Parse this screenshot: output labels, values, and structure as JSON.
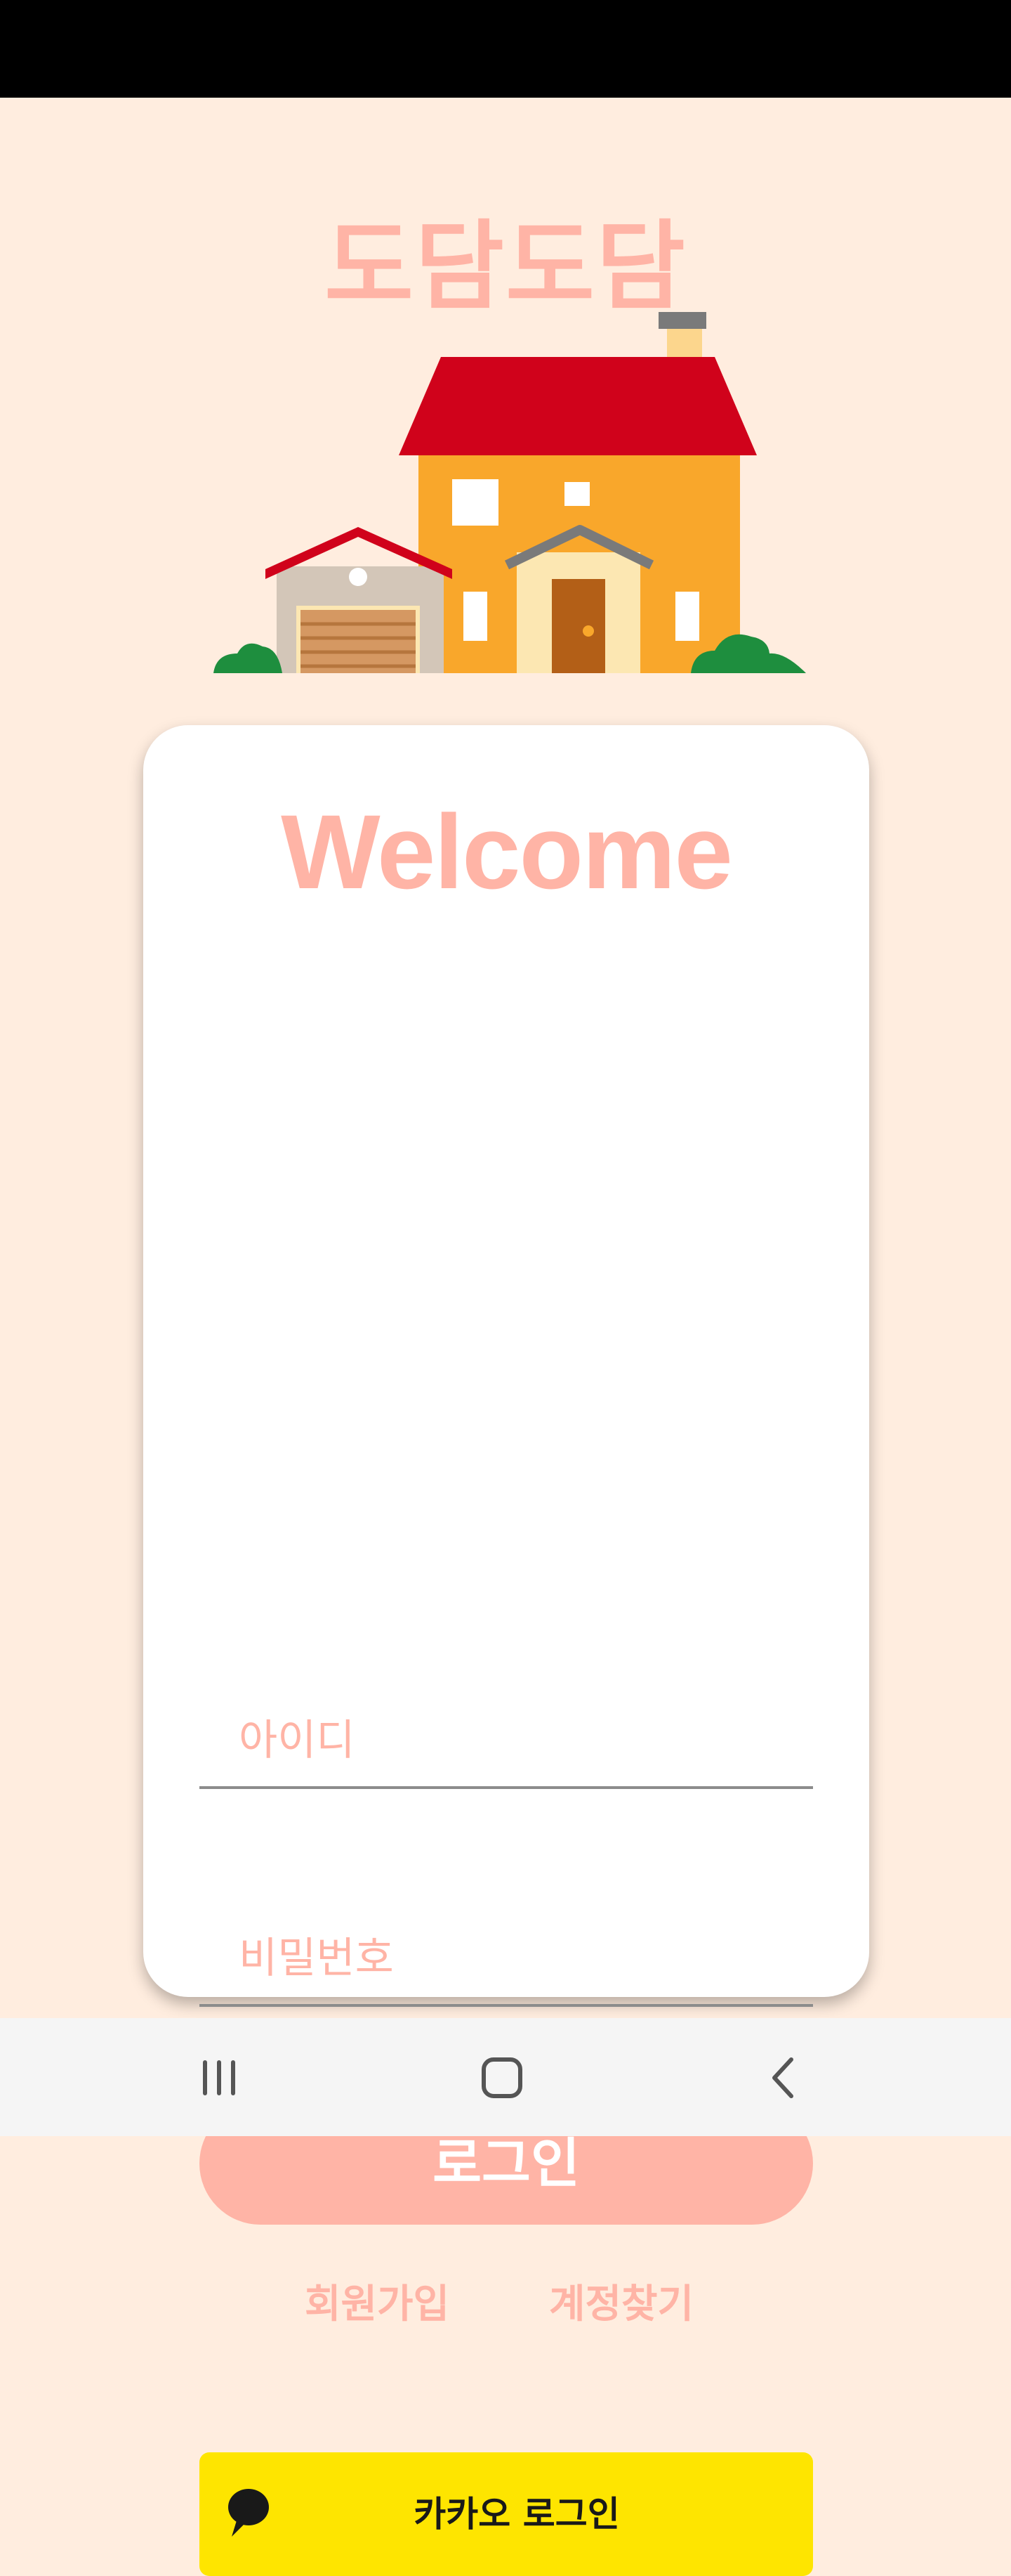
{
  "app": {
    "title": "도담도담"
  },
  "login_card": {
    "welcome": "Welcome",
    "id_field": {
      "placeholder": "아이디",
      "value": ""
    },
    "password_field": {
      "placeholder": "비밀번호",
      "value": ""
    },
    "login_button": "로그인",
    "signup_link": "회원가입",
    "find_account_link": "계정찾기",
    "kakao_button": {
      "label": "카카오 로그인",
      "icon": "kakao-speech-bubble-icon",
      "color": "#FEE500"
    }
  },
  "navigation_bar": {
    "buttons": [
      {
        "icon": "recent-apps-icon"
      },
      {
        "icon": "home-icon"
      },
      {
        "icon": "back-icon"
      }
    ]
  },
  "colors": {
    "background": "#FFEDDF",
    "accent": "#FFB4A6",
    "kakao": "#FEE500"
  }
}
